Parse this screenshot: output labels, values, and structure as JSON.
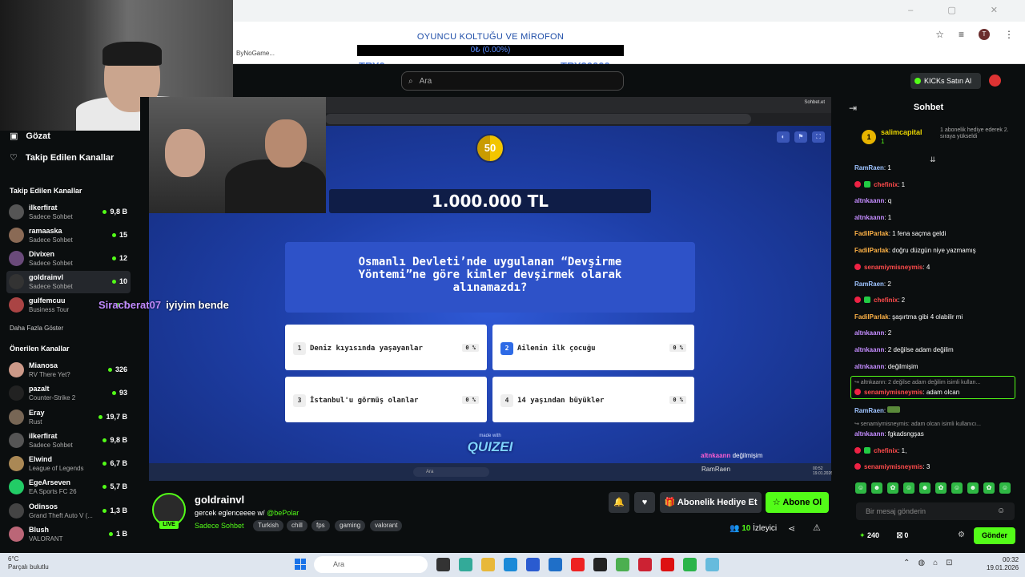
{
  "browser": {
    "bookmark": "ByNoGame...",
    "window_controls": "– ▢ ✕",
    "profile_letter": "T"
  },
  "donation": {
    "title": "OYUNCU KOLTUĞU VE MİROFON",
    "progress_text": "0₺ (0.00%)",
    "progress": 0,
    "min": "TRY0",
    "max": "TRY20000"
  },
  "kick_header": {
    "search_placeholder": "Ara",
    "kicks_label": "KICKs Satın Al"
  },
  "sidebar": {
    "top_items": [
      {
        "label": "Gözat"
      },
      {
        "label": "Takip Edilen Kanallar"
      }
    ],
    "followed_heading": "Takip Edilen Kanallar",
    "followed": [
      {
        "name": "ilkerfirat",
        "sub": "Sadece Sohbet",
        "viewers": "9,8 B"
      },
      {
        "name": "ramaaska",
        "sub": "Sadece Sohbet",
        "viewers": "15"
      },
      {
        "name": "Divixen",
        "sub": "Sadece Sohbet",
        "viewers": "12"
      },
      {
        "name": "goldrainvl",
        "sub": "Sadece Sohbet",
        "viewers": "10"
      },
      {
        "name": "gulfemcuu",
        "sub": "Business Tour",
        "viewers": "7"
      }
    ],
    "more_label": "Daha Fazla Göster",
    "recommended_heading": "Önerilen Kanallar",
    "recommended": [
      {
        "name": "Mianosa",
        "sub": "RV There Yet?",
        "viewers": "326"
      },
      {
        "name": "pazalt",
        "sub": "Counter-Strike 2",
        "viewers": "93"
      },
      {
        "name": "Eray",
        "sub": "Rust",
        "viewers": "19,7 B"
      },
      {
        "name": "ilkerfirat",
        "sub": "Sadece Sohbet",
        "viewers": "9,8 B"
      },
      {
        "name": "Elwind",
        "sub": "League of Legends",
        "viewers": "6,7 B"
      },
      {
        "name": "EgeArseven",
        "sub": "EA Sports FC 26",
        "viewers": "5,7 B"
      },
      {
        "name": "Odinsos",
        "sub": "Grand Theft Auto V (...",
        "viewers": "1,3 B"
      },
      {
        "name": "Blush",
        "sub": "VALORANT",
        "viewers": "1 B"
      }
    ]
  },
  "stream": {
    "overlay_chat_user": "Siracberat07",
    "overlay_chat_msg": "iyiyim bende",
    "ss_tab": "Sohbet.et",
    "timer": "50",
    "prize": "1.000.000 TL",
    "question": "Osmanlı Devleti’nde uygulanan “Devşirme Yöntemi”ne göre kimler devşirmek olarak alınamazdı?",
    "answers": [
      {
        "num": "1",
        "text": "Deniz kıyısında yaşayanlar",
        "pct": "0 %"
      },
      {
        "num": "2",
        "text": "Ailenin ilk çocuğu",
        "pct": "0 %"
      },
      {
        "num": "3",
        "text": "İstanbul'u görmüş olanlar",
        "pct": "0 %"
      },
      {
        "num": "4",
        "text": "14 yaşından büyükler",
        "pct": "0 %"
      }
    ],
    "made_with": "made with",
    "brand": "QUIZEI",
    "overlay_user": "altnkaann",
    "overlay_msg": "değilmişim",
    "overlay_user2": "RamRaen",
    "ss_search": "Ara",
    "ss_time": "00:52",
    "ss_date": "19.01.2026"
  },
  "info": {
    "live": "LIVE",
    "streamer": "goldrainvl",
    "title_prefix": "gercek eglenceeee w/ ",
    "title_mention": "@bePolar",
    "category": "Sadece Sohbet",
    "tags": [
      "Turkish",
      "chill",
      "fps",
      "gaming",
      "valorant"
    ],
    "gift_label": "Abonelik Hediye Et",
    "subscribe_label": "Abone Ol",
    "viewers": "10",
    "viewers_label": "İzleyici"
  },
  "chat": {
    "title": "Sohbet",
    "pinned": {
      "rank": "1",
      "name": "salimcapital",
      "amount": "1",
      "text": "1 abonelik hediye ederek 2. sıraya yükseldi"
    },
    "messages": [
      {
        "user": "RamRaen",
        "color": "#9ec3ff",
        "text": ": 1",
        "badges": []
      },
      {
        "user": "chefinix",
        "color": "#ff4b4b",
        "text": ": 1",
        "badges": [
          "red",
          "green"
        ]
      },
      {
        "user": "altnkaann",
        "color": "#c48cff",
        "text": ": q",
        "badges": []
      },
      {
        "user": "altnkaann",
        "color": "#c48cff",
        "text": ": 1",
        "badges": []
      },
      {
        "user": "FadilParlak",
        "color": "#ffb347",
        "text": ": 1 fena saçma geldi",
        "badges": []
      },
      {
        "user": "FadilParlak",
        "color": "#ffb347",
        "text": ": doğru düzgün niye yazmamış",
        "badges": []
      },
      {
        "user": "senamiymisneymis",
        "color": "#ff4b4b",
        "text": ": 4",
        "badges": [
          "red"
        ]
      },
      {
        "user": "RamRaen",
        "color": "#9ec3ff",
        "text": ": 2",
        "badges": []
      },
      {
        "user": "chefinix",
        "color": "#ff4b4b",
        "text": ": 2",
        "badges": [
          "red",
          "green"
        ]
      },
      {
        "user": "FadilParlak",
        "color": "#ffb347",
        "text": ": şaşırtma gibi 4 olabilir mi",
        "badges": []
      },
      {
        "user": "altnkaann",
        "color": "#c48cff",
        "text": ": 2",
        "badges": []
      },
      {
        "user": "altnkaann",
        "color": "#c48cff",
        "text": ": 2 değilse adam değilim",
        "badges": []
      },
      {
        "user": "altnkaann",
        "color": "#c48cff",
        "text": ": değilmişim",
        "badges": []
      }
    ],
    "reply1_ref": "↪ altnkaann: 2 değilse adam değilim isimli kullan...",
    "reply1_user": "senamiymisneymis",
    "reply1_text": ": adam olcan",
    "msg_ramraen": "RamRaen",
    "msg_ramraen_text": ":",
    "reply2_ref": "↪ senamiymisneymis: adam olcan isimli kullanıcı...",
    "reply2_user": "altnkaann",
    "reply2_text": ": fgkadsngşas",
    "msg_chef_user": "chefinix",
    "msg_chef_text": ": 1,",
    "msg_sena_user": "senamiymisneymis",
    "msg_sena_text": ": 3",
    "input_placeholder": "Bir mesaj gönderin",
    "points": "240",
    "count": "0",
    "send_label": "Gönder"
  },
  "taskbar": {
    "temp": "6°C",
    "weather": "Parçalı bulutlu",
    "search": "Ara",
    "time": "00:32",
    "date": "19.01.2026"
  }
}
